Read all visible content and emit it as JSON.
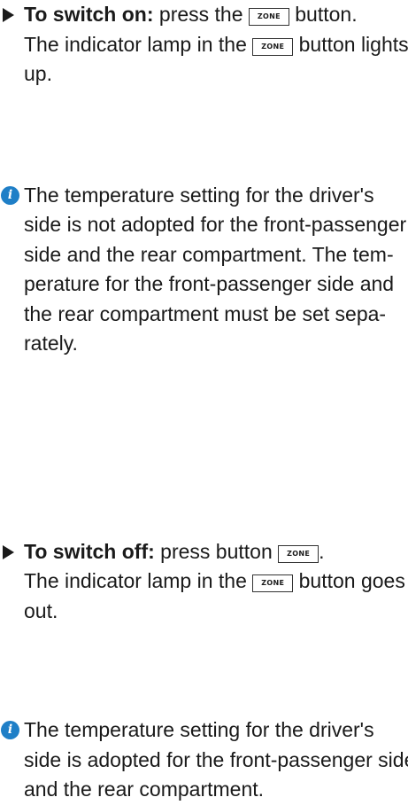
{
  "step_on": {
    "label": "To switch on:",
    "text_1": " press the ",
    "key": "ZONE",
    "text_2": " button.",
    "line2_a": "The indicator lamp in the ",
    "line2_key": "ZONE",
    "line2_b": " button lights",
    "line3": "up."
  },
  "note_1": {
    "icon": "i",
    "lines": [
      "The temperature setting for the driver's",
      "side is not adopted for the front-passenger",
      "side and the rear compartment. The tem-",
      "perature for the front-passenger side and",
      "the rear compartment must be set sepa-",
      "rately."
    ]
  },
  "step_off": {
    "label": "To switch off:",
    "text_1": " press button ",
    "key": "ZONE",
    "text_2": ".",
    "line2_a": "The indicator lamp in the ",
    "line2_key": "ZONE",
    "line2_b": " button goes",
    "line3": "out."
  },
  "note_2": {
    "icon": "i",
    "lines": [
      "The temperature setting for the driver's",
      "side is adopted for the front-passenger side",
      "and the rear compartment."
    ]
  }
}
